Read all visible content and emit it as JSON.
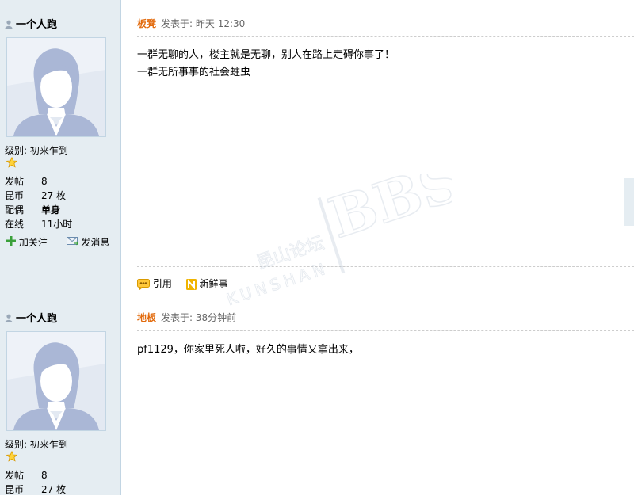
{
  "posts": [
    {
      "username": "一个人跑",
      "level_label": "级别: 初来乍到",
      "stats": [
        {
          "label": "发帖",
          "value": "8",
          "bold": false
        },
        {
          "label": "昆币",
          "value": "27 枚",
          "bold": false
        },
        {
          "label": "配偶",
          "value": "单身",
          "bold": true
        },
        {
          "label": "在线",
          "value": "11小时",
          "bold": false
        }
      ],
      "actions": {
        "follow": "加关注",
        "message": "发消息"
      },
      "floor": "板凳",
      "posted": "发表于: 昨天 12:30",
      "message_lines": [
        "一群无聊的人，楼主就是无聊，别人在路上走碍你事了！",
        "一群无所事事的社会蛀虫"
      ],
      "ops": {
        "quote": "引用",
        "news": "新鲜事"
      }
    },
    {
      "username": "一个人跑",
      "level_label": "级别: 初来乍到",
      "stats": [
        {
          "label": "发帖",
          "value": "8",
          "bold": false
        },
        {
          "label": "昆币",
          "value": "27 枚",
          "bold": false
        }
      ],
      "floor": "地板",
      "posted": "发表于: 38分钟前",
      "message_lines": [
        "pf1129，你家里死人啦，好久的事情又拿出来，"
      ]
    }
  ],
  "watermark": {
    "main": "BBS",
    "sub": "KUNSHAN",
    "cn": "昆山论坛"
  },
  "colors": {
    "sidebar_bg": "#e5edf2",
    "border": "#c2d5e3",
    "floor_name": "#e26a0c"
  }
}
